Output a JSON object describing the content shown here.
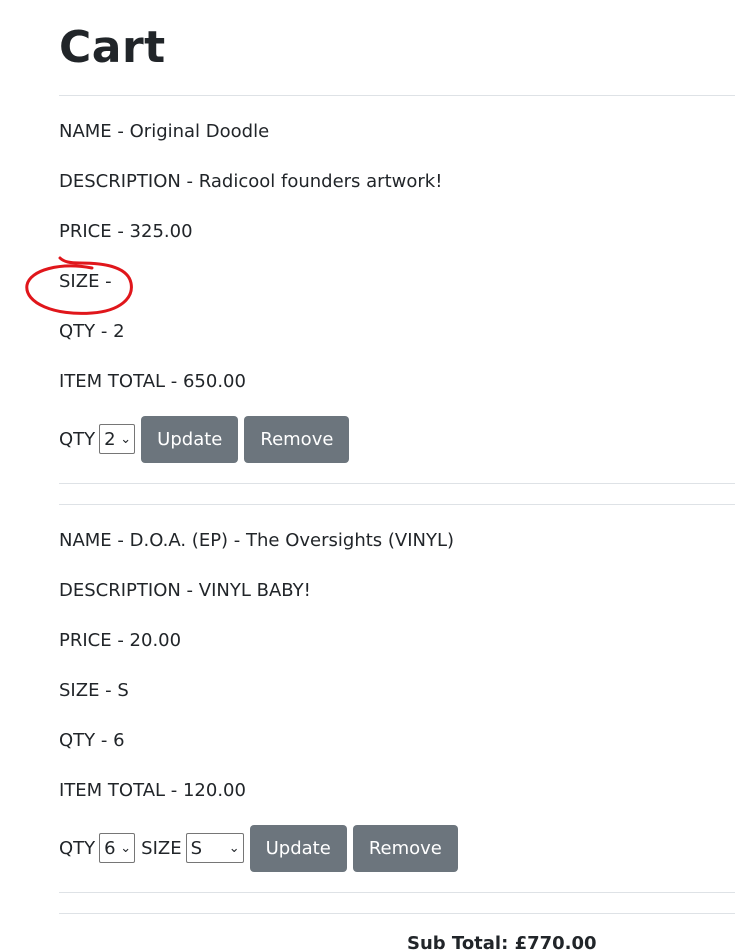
{
  "page": {
    "title": "Cart"
  },
  "items": [
    {
      "name_line": "NAME - Original Doodle",
      "description_line": "DESCRIPTION - Radicool founders artwork!",
      "price_line": "PRICE - 325.00",
      "size_line": "SIZE -",
      "qty_line": "QTY - 2",
      "total_line": "ITEM TOTAL - 650.00",
      "qty_label": "QTY",
      "qty_value": "2",
      "update_label": "Update",
      "remove_label": "Remove"
    },
    {
      "name_line": "NAME - D.O.A. (EP) - The Oversights (VINYL)",
      "description_line": "DESCRIPTION - VINYL BABY!",
      "price_line": "PRICE - 20.00",
      "size_line": "SIZE - S",
      "qty_line": "QTY - 6",
      "total_line": "ITEM TOTAL - 120.00",
      "qty_label": "QTY",
      "qty_value": "6",
      "size_label": "SIZE",
      "size_value": "S",
      "update_label": "Update",
      "remove_label": "Remove"
    }
  ],
  "summary": {
    "subtotal_line": "Sub Total: £770.00"
  },
  "colors": {
    "button_bg": "#6c757d",
    "annotation": "#e0161b",
    "divider": "#dee2e6"
  },
  "icons": {
    "select_chevron": "chevron-down-icon"
  }
}
